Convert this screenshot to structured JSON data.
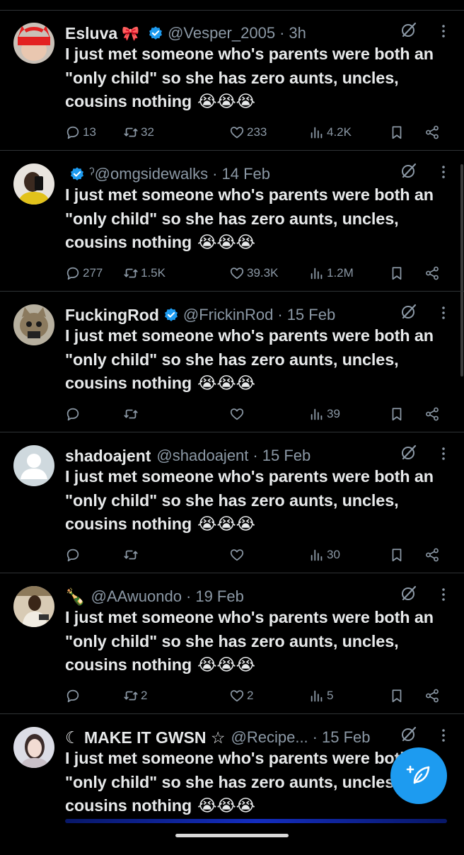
{
  "tweets": [
    {
      "name": "Esluva",
      "deco": "🎀",
      "verified": true,
      "handle": "@Vesper_2005",
      "time": "3h",
      "text": "I just met someone who's parents were both an \"only child\" so she has zero aunts, uncles, cousins nothing",
      "replies": "13",
      "retweets": "32",
      "likes": "233",
      "views": "4.2K",
      "avatar": "red-devil"
    },
    {
      "name": "",
      "deco": "",
      "verified": true,
      "handle": "ˀ@omgsidewalks",
      "time": "14 Feb",
      "text": "I just met someone who's parents were both an \"only child\" so she has zero aunts, uncles, cousins nothing",
      "replies": "277",
      "retweets": "1.5K",
      "likes": "39.3K",
      "views": "1.2M",
      "avatar": "selfie"
    },
    {
      "name": "FuckingRod",
      "deco": "",
      "verified": true,
      "handle": "@FrickinRod",
      "time": "15 Feb",
      "text": "I just met someone who's parents were both an \"only child\" so she has zero aunts, uncles, cousins nothing",
      "replies": "",
      "retweets": "",
      "likes": "",
      "views": "39",
      "avatar": "cat"
    },
    {
      "name": "shadoajent",
      "deco": "",
      "verified": false,
      "handle": "@shadoajent",
      "time": "15 Feb",
      "text": "I just met someone who's parents were both an \"only child\" so she has zero aunts, uncles, cousins nothing",
      "replies": "",
      "retweets": "",
      "likes": "",
      "views": "30",
      "avatar": "default"
    },
    {
      "name": "🍾",
      "deco": "",
      "verified": false,
      "handle": "@AAwuondo",
      "time": "19 Feb",
      "text": "I just met someone who's parents were both an \"only child\" so she has zero aunts, uncles, cousins nothing",
      "replies": "",
      "retweets": "2",
      "likes": "2",
      "views": "5",
      "avatar": "man"
    },
    {
      "name": "☾ MAKE IT GWSN ☆",
      "deco": "",
      "verified": false,
      "handle": "@Recipe...",
      "time": "15 Feb",
      "text": "I just met someone who's parents were both an \"only child\" so she has zero aunts, uncles, cousins nothing",
      "replies": "",
      "retweets": "",
      "likes": "",
      "views": "",
      "avatar": "girl"
    }
  ],
  "emoji": "😭😭😭",
  "colors": {
    "accent": "#1d9bf0",
    "muted": "#8b98a5",
    "divider": "#2f3336",
    "text": "#e7e9ea"
  },
  "icons": {
    "reply": "reply-icon",
    "retweet": "retweet-icon",
    "like": "heart-icon",
    "views": "views-icon",
    "bookmark": "bookmark-icon",
    "share": "share-icon",
    "grok": "grok-icon",
    "more": "more-icon",
    "compose": "compose-icon"
  }
}
